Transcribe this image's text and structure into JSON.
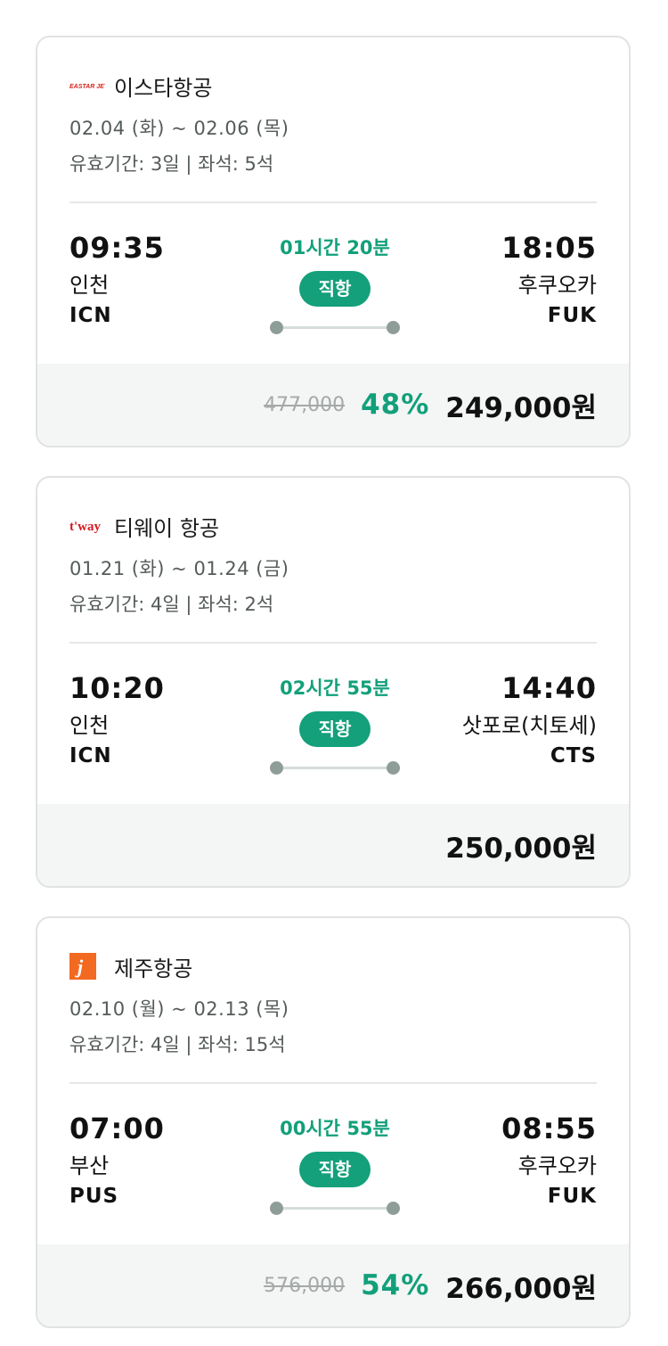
{
  "flights": [
    {
      "logo_icon": "eastar-jet-logo-icon",
      "logo_text": "EASTAR JET",
      "airline": "이스타항공",
      "dates": "02.04 (화) ~ 02.06 (목)",
      "validity": "유효기간: 3일 | 좌석: 5석",
      "departure": {
        "time": "09:35",
        "city": "인천",
        "code": "ICN"
      },
      "duration": "01시간 20분",
      "type": "직항",
      "arrival": {
        "time": "18:05",
        "city": "후쿠오카",
        "code": "FUK"
      },
      "original_price": "477,000",
      "discount": "48%",
      "price": "249,000원"
    },
    {
      "logo_icon": "tway-logo-icon",
      "logo_text": "t'way",
      "airline": "티웨이 항공",
      "dates": "01.21 (화) ~ 01.24 (금)",
      "validity": "유효기간: 4일 | 좌석: 2석",
      "departure": {
        "time": "10:20",
        "city": "인천",
        "code": "ICN"
      },
      "duration": "02시간 55분",
      "type": "직항",
      "arrival": {
        "time": "14:40",
        "city": "삿포로(치토세)",
        "code": "CTS"
      },
      "original_price": "",
      "discount": "",
      "price": "250,000원"
    },
    {
      "logo_icon": "jeju-air-logo-icon",
      "logo_text": "j",
      "airline": "제주항공",
      "dates": "02.10 (월) ~ 02.13 (목)",
      "validity": "유효기간: 4일 | 좌석: 15석",
      "departure": {
        "time": "07:00",
        "city": "부산",
        "code": "PUS"
      },
      "duration": "00시간 55분",
      "type": "직항",
      "arrival": {
        "time": "08:55",
        "city": "후쿠오카",
        "code": "FUK"
      },
      "original_price": "576,000",
      "discount": "54%",
      "price": "266,000원"
    }
  ],
  "colors": {
    "accent": "#13a07b",
    "eastar_red": "#d7261e",
    "tway_red": "#d71920",
    "jeju_orange": "#f26a21"
  }
}
